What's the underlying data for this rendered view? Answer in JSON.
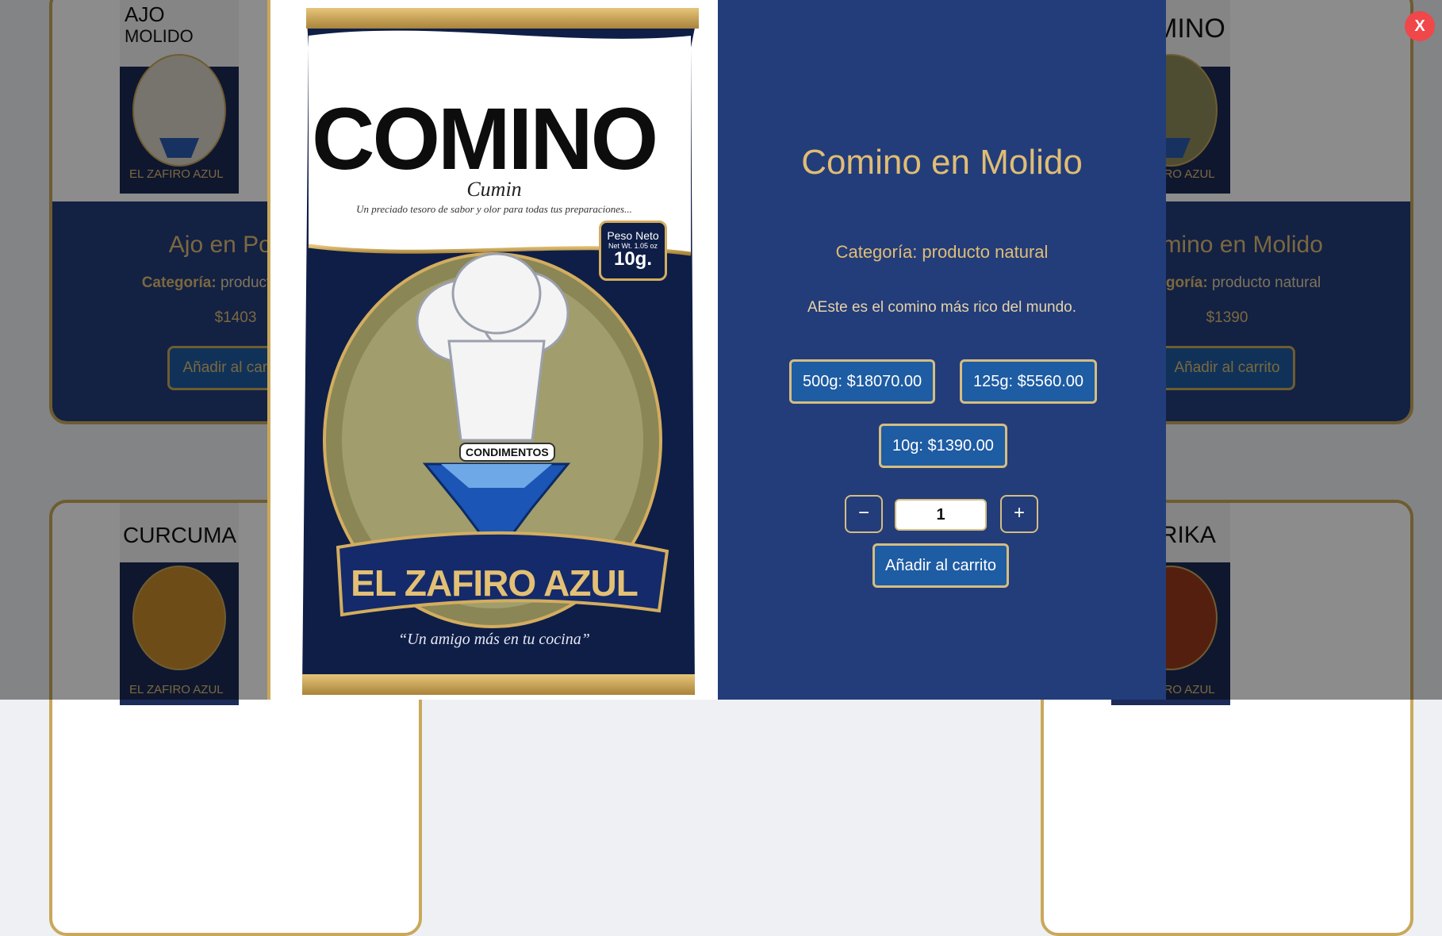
{
  "cards": [
    {
      "title": "Ajo en Polvo",
      "category_label": "Categoría:",
      "category_value": "producto natural",
      "price": "$1403",
      "button": "Añadir al carrito",
      "image_alt": "AJO MOLIDO"
    },
    {
      "title": "Comino en Molido",
      "category_label": "Categoría:",
      "category_value": "producto natural",
      "price": "$1390",
      "button": "Añadir al carrito",
      "image_alt": "COMINO"
    },
    {
      "image_alt": "CURCUMA"
    },
    {
      "image_alt": "PAPRIKA"
    }
  ],
  "modal": {
    "title": "Comino en Molido",
    "category": "Categoría: producto natural",
    "description": "AEste es el comino más rico del mundo.",
    "options": [
      {
        "label": "500g: $18070.00"
      },
      {
        "label": "125g: $5560.00"
      },
      {
        "label": "10g: $1390.00"
      }
    ],
    "quantity": "1",
    "decrement": "−",
    "increment": "+",
    "add_to_cart": "Añadir al carrito",
    "close": "X"
  },
  "package": {
    "name": "COMINO",
    "subtitle": "Cumin",
    "tagline": "Un preciado tesoro de sabor y olor para todas tus preparaciones...",
    "weight_label": "Peso Neto",
    "weight_net": "Net Wt. 1.05 oz",
    "weight": "10g.",
    "badge": "CONDIMENTOS",
    "brand": "EL ZAFIRO AZUL",
    "slogan": "“Un amigo más en tu cocina”"
  },
  "colors": {
    "navy": "#233d7a",
    "gold": "#e0bd74",
    "button_blue": "#1e5ca3",
    "close_red": "#f0474a"
  }
}
